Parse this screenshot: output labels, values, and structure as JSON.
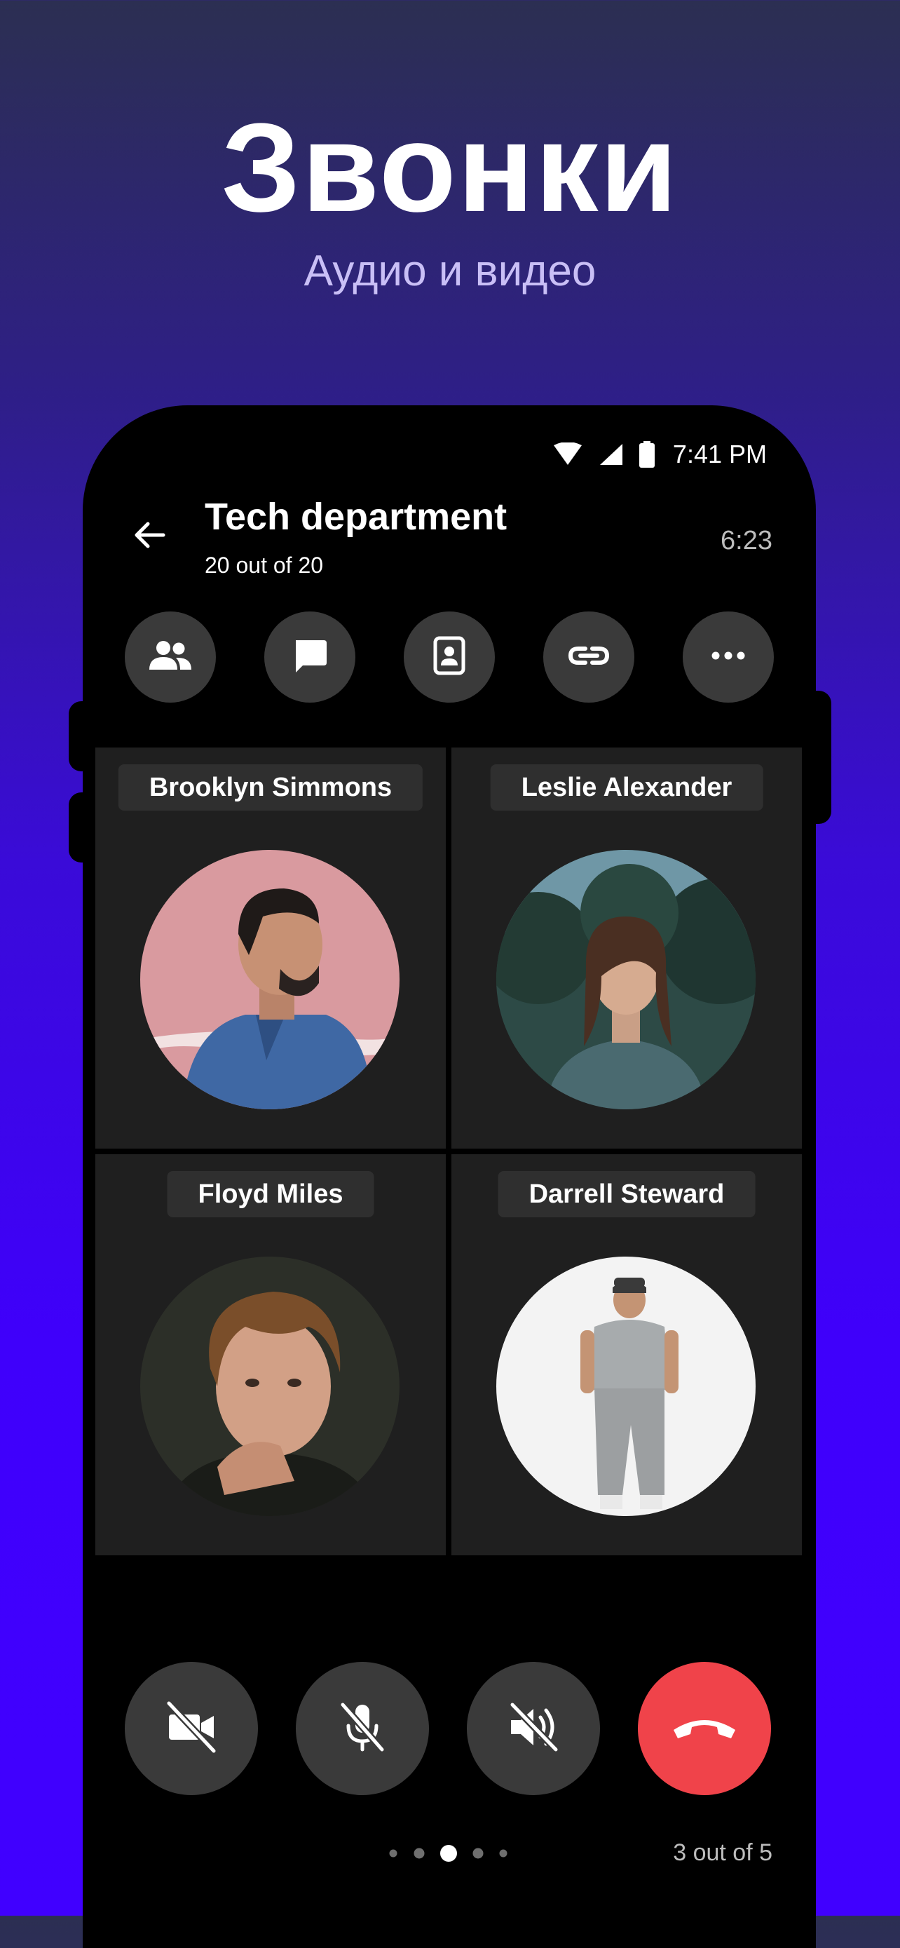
{
  "hero": {
    "title": "Звонки",
    "subtitle": "Аудио и видео"
  },
  "status_bar": {
    "time": "7:41 PM",
    "icons": [
      "wifi-icon",
      "signal-icon",
      "battery-icon"
    ]
  },
  "call": {
    "title": "Tech department",
    "participants_summary": "20 out of 20",
    "timer": "6:23"
  },
  "actions": [
    {
      "name": "participants-button",
      "icon": "people-icon"
    },
    {
      "name": "chat-button",
      "icon": "chat-icon"
    },
    {
      "name": "contact-card-button",
      "icon": "contact-card-icon"
    },
    {
      "name": "invite-link-button",
      "icon": "link-icon"
    },
    {
      "name": "more-button",
      "icon": "more-icon"
    }
  ],
  "participants": [
    {
      "name": "Brooklyn Simmons"
    },
    {
      "name": "Leslie Alexander"
    },
    {
      "name": "Floyd Miles"
    },
    {
      "name": "Darrell Steward"
    }
  ],
  "controls": [
    {
      "name": "camera-toggle-button",
      "icon": "camera-off-icon"
    },
    {
      "name": "mic-toggle-button",
      "icon": "mic-off-icon"
    },
    {
      "name": "speaker-toggle-button",
      "icon": "speaker-off-icon"
    },
    {
      "name": "end-call-button",
      "icon": "end-call-icon"
    }
  ],
  "pager": {
    "current": 3,
    "total": 5,
    "label": "3 out of 5"
  },
  "colors": {
    "end_call": "#f0434a",
    "button_bg": "#3a3a3a",
    "tile_bg": "#1f1f1f",
    "background_top": "#2c2f52",
    "background_bottom": "#4000ff"
  }
}
